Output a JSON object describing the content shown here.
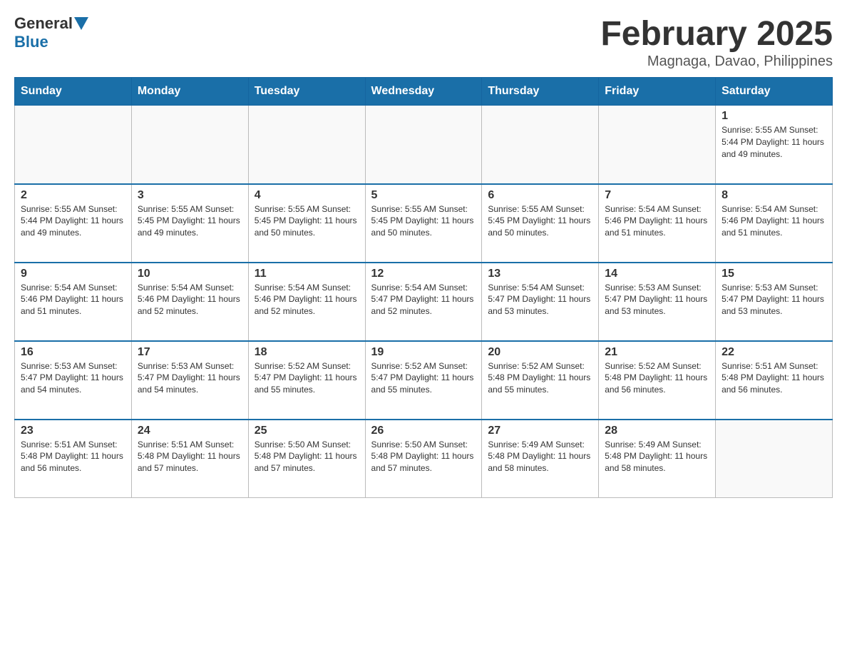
{
  "header": {
    "logo_general": "General",
    "logo_blue": "Blue",
    "title": "February 2025",
    "subtitle": "Magnaga, Davao, Philippines"
  },
  "calendar": {
    "days_of_week": [
      "Sunday",
      "Monday",
      "Tuesday",
      "Wednesday",
      "Thursday",
      "Friday",
      "Saturday"
    ],
    "weeks": [
      [
        {
          "day": "",
          "info": ""
        },
        {
          "day": "",
          "info": ""
        },
        {
          "day": "",
          "info": ""
        },
        {
          "day": "",
          "info": ""
        },
        {
          "day": "",
          "info": ""
        },
        {
          "day": "",
          "info": ""
        },
        {
          "day": "1",
          "info": "Sunrise: 5:55 AM\nSunset: 5:44 PM\nDaylight: 11 hours and 49 minutes."
        }
      ],
      [
        {
          "day": "2",
          "info": "Sunrise: 5:55 AM\nSunset: 5:44 PM\nDaylight: 11 hours and 49 minutes."
        },
        {
          "day": "3",
          "info": "Sunrise: 5:55 AM\nSunset: 5:45 PM\nDaylight: 11 hours and 49 minutes."
        },
        {
          "day": "4",
          "info": "Sunrise: 5:55 AM\nSunset: 5:45 PM\nDaylight: 11 hours and 50 minutes."
        },
        {
          "day": "5",
          "info": "Sunrise: 5:55 AM\nSunset: 5:45 PM\nDaylight: 11 hours and 50 minutes."
        },
        {
          "day": "6",
          "info": "Sunrise: 5:55 AM\nSunset: 5:45 PM\nDaylight: 11 hours and 50 minutes."
        },
        {
          "day": "7",
          "info": "Sunrise: 5:54 AM\nSunset: 5:46 PM\nDaylight: 11 hours and 51 minutes."
        },
        {
          "day": "8",
          "info": "Sunrise: 5:54 AM\nSunset: 5:46 PM\nDaylight: 11 hours and 51 minutes."
        }
      ],
      [
        {
          "day": "9",
          "info": "Sunrise: 5:54 AM\nSunset: 5:46 PM\nDaylight: 11 hours and 51 minutes."
        },
        {
          "day": "10",
          "info": "Sunrise: 5:54 AM\nSunset: 5:46 PM\nDaylight: 11 hours and 52 minutes."
        },
        {
          "day": "11",
          "info": "Sunrise: 5:54 AM\nSunset: 5:46 PM\nDaylight: 11 hours and 52 minutes."
        },
        {
          "day": "12",
          "info": "Sunrise: 5:54 AM\nSunset: 5:47 PM\nDaylight: 11 hours and 52 minutes."
        },
        {
          "day": "13",
          "info": "Sunrise: 5:54 AM\nSunset: 5:47 PM\nDaylight: 11 hours and 53 minutes."
        },
        {
          "day": "14",
          "info": "Sunrise: 5:53 AM\nSunset: 5:47 PM\nDaylight: 11 hours and 53 minutes."
        },
        {
          "day": "15",
          "info": "Sunrise: 5:53 AM\nSunset: 5:47 PM\nDaylight: 11 hours and 53 minutes."
        }
      ],
      [
        {
          "day": "16",
          "info": "Sunrise: 5:53 AM\nSunset: 5:47 PM\nDaylight: 11 hours and 54 minutes."
        },
        {
          "day": "17",
          "info": "Sunrise: 5:53 AM\nSunset: 5:47 PM\nDaylight: 11 hours and 54 minutes."
        },
        {
          "day": "18",
          "info": "Sunrise: 5:52 AM\nSunset: 5:47 PM\nDaylight: 11 hours and 55 minutes."
        },
        {
          "day": "19",
          "info": "Sunrise: 5:52 AM\nSunset: 5:47 PM\nDaylight: 11 hours and 55 minutes."
        },
        {
          "day": "20",
          "info": "Sunrise: 5:52 AM\nSunset: 5:48 PM\nDaylight: 11 hours and 55 minutes."
        },
        {
          "day": "21",
          "info": "Sunrise: 5:52 AM\nSunset: 5:48 PM\nDaylight: 11 hours and 56 minutes."
        },
        {
          "day": "22",
          "info": "Sunrise: 5:51 AM\nSunset: 5:48 PM\nDaylight: 11 hours and 56 minutes."
        }
      ],
      [
        {
          "day": "23",
          "info": "Sunrise: 5:51 AM\nSunset: 5:48 PM\nDaylight: 11 hours and 56 minutes."
        },
        {
          "day": "24",
          "info": "Sunrise: 5:51 AM\nSunset: 5:48 PM\nDaylight: 11 hours and 57 minutes."
        },
        {
          "day": "25",
          "info": "Sunrise: 5:50 AM\nSunset: 5:48 PM\nDaylight: 11 hours and 57 minutes."
        },
        {
          "day": "26",
          "info": "Sunrise: 5:50 AM\nSunset: 5:48 PM\nDaylight: 11 hours and 57 minutes."
        },
        {
          "day": "27",
          "info": "Sunrise: 5:49 AM\nSunset: 5:48 PM\nDaylight: 11 hours and 58 minutes."
        },
        {
          "day": "28",
          "info": "Sunrise: 5:49 AM\nSunset: 5:48 PM\nDaylight: 11 hours and 58 minutes."
        },
        {
          "day": "",
          "info": ""
        }
      ]
    ]
  }
}
